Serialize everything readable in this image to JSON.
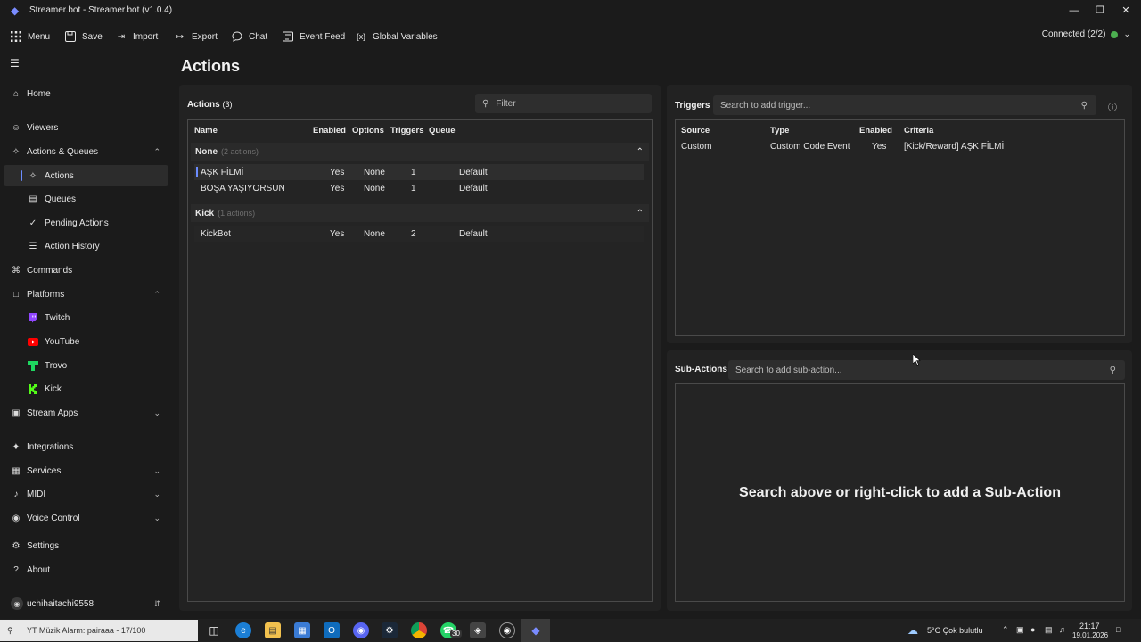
{
  "window": {
    "title": "Streamer.bot - Streamer.bot (v1.0.4)",
    "controls": {
      "minimize": "—",
      "maximize": "❐",
      "close": "✕"
    }
  },
  "toolbar": {
    "menu": "Menu",
    "save": "Save",
    "import": "Import",
    "export": "Export",
    "chat": "Chat",
    "event_feed": "Event Feed",
    "global_variables": "Global Variables",
    "connection": "Connected (2/2)"
  },
  "sidebar": {
    "home": "Home",
    "viewers": "Viewers",
    "actions_queues": "Actions & Queues",
    "actions": "Actions",
    "queues": "Queues",
    "pending_actions": "Pending Actions",
    "action_history": "Action History",
    "commands": "Commands",
    "platforms": "Platforms",
    "twitch": "Twitch",
    "youtube": "YouTube",
    "trovo": "Trovo",
    "kick": "Kick",
    "stream_apps": "Stream Apps",
    "integrations": "Integrations",
    "services": "Services",
    "midi": "MIDI",
    "voice_control": "Voice Control",
    "settings": "Settings",
    "about": "About",
    "user": "uchihaitachi9558"
  },
  "page": {
    "title": "Actions"
  },
  "actions_panel": {
    "label": "Actions",
    "count": "(3)",
    "filter_placeholder": "Filter",
    "columns": {
      "name": "Name",
      "enabled": "Enabled",
      "options": "Options",
      "triggers": "Triggers",
      "queue": "Queue"
    },
    "groups": [
      {
        "name": "None",
        "count": "(2 actions)",
        "rows": [
          {
            "name": "AŞK FİLMİ",
            "enabled": "Yes",
            "options": "None",
            "triggers": "1",
            "queue": "Default"
          },
          {
            "name": "BOŞA YAŞIYORSUN",
            "enabled": "Yes",
            "options": "None",
            "triggers": "1",
            "queue": "Default"
          }
        ]
      },
      {
        "name": "Kick",
        "count": "(1 actions)",
        "rows": [
          {
            "name": "KickBot",
            "enabled": "Yes",
            "options": "None",
            "triggers": "2",
            "queue": "Default"
          }
        ]
      }
    ]
  },
  "triggers_panel": {
    "label": "Triggers",
    "search_placeholder": "Search to add trigger...",
    "columns": {
      "source": "Source",
      "type": "Type",
      "enabled": "Enabled",
      "criteria": "Criteria"
    },
    "rows": [
      {
        "source": "Custom",
        "type": "Custom Code Event",
        "enabled": "Yes",
        "criteria": "[Kick/Reward] AŞK FİLMİ"
      }
    ]
  },
  "subactions_panel": {
    "label": "Sub-Actions",
    "search_placeholder": "Search to add sub-action...",
    "empty_message": "Search above or right-click to add a Sub-Action"
  },
  "taskbar": {
    "search_text": "YT Müzik Alarm: pairaaa - 17/100",
    "whatsapp_badge": "30",
    "weather": "5°C  Çok bulutlu",
    "time": "21:17",
    "date": "19.01.2026"
  },
  "colors": {
    "accent": "#6b8cff",
    "connected": "#4caf50",
    "youtube": "#ff0000",
    "twitch": "#9146ff",
    "trovo": "#1ed760",
    "kick": "#53fc18"
  }
}
